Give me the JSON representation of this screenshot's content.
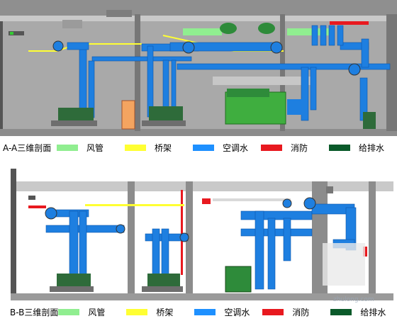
{
  "section_a": {
    "title": "A-A三维剖面"
  },
  "section_b": {
    "title": "B-B三维剖面"
  },
  "legend": [
    {
      "label": "风管",
      "color": "#90ee90"
    },
    {
      "label": "桥架",
      "color": "#ffff33"
    },
    {
      "label": "空调水",
      "color": "#1e90ff"
    },
    {
      "label": "消防",
      "color": "#e8191f"
    },
    {
      "label": "给排水",
      "color": "#0a5a2a"
    }
  ],
  "watermark": {
    "text": "zhulong.com"
  },
  "colors": {
    "wall": "#b4b4b4",
    "pipe": "#1e7fe0",
    "equipment": "#2e8b3a",
    "chiller": "#3fae3f",
    "door": "#f4a460"
  }
}
